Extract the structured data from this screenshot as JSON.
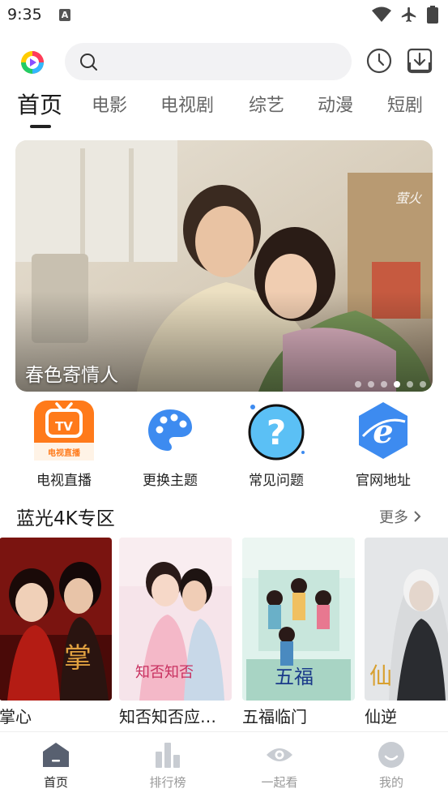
{
  "status_bar": {
    "time": "9:35",
    "notification_badge": "A"
  },
  "header": {
    "logo": "app-logo",
    "search_placeholder": ""
  },
  "tabs": [
    {
      "label": "首页",
      "active": true
    },
    {
      "label": "电影",
      "active": false
    },
    {
      "label": "电视剧",
      "active": false
    },
    {
      "label": "综艺",
      "active": false
    },
    {
      "label": "动漫",
      "active": false
    },
    {
      "label": "短剧",
      "active": false
    }
  ],
  "banner": {
    "title": "春色寄情人",
    "dot_count": 6,
    "active_dot": 3
  },
  "quick_entries": [
    {
      "label": "电视直播",
      "icon": "tv-live-icon",
      "icon_text": "电视直播"
    },
    {
      "label": "更换主题",
      "icon": "palette-icon"
    },
    {
      "label": "常见问题",
      "icon": "question-icon"
    },
    {
      "label": "官网地址",
      "icon": "browser-e-icon"
    }
  ],
  "section": {
    "title": "蓝光4K专区",
    "more_label": "更多"
  },
  "posters": [
    {
      "title": "掌心"
    },
    {
      "title": "知否知否应是绿肥红瘦"
    },
    {
      "title": "五福临门"
    },
    {
      "title": "仙逆"
    }
  ],
  "bottom_nav": [
    {
      "label": "首页",
      "icon": "home-icon",
      "active": true
    },
    {
      "label": "排行榜",
      "icon": "chart-bar-icon",
      "active": false
    },
    {
      "label": "一起看",
      "icon": "eye-icon",
      "active": false
    },
    {
      "label": "我的",
      "icon": "user-icon",
      "active": false
    }
  ],
  "colors": {
    "accent": "#3d8bf0",
    "orange": "#ff7a1a",
    "nav_active": "#222222",
    "nav_inactive": "#c8ccd2"
  }
}
